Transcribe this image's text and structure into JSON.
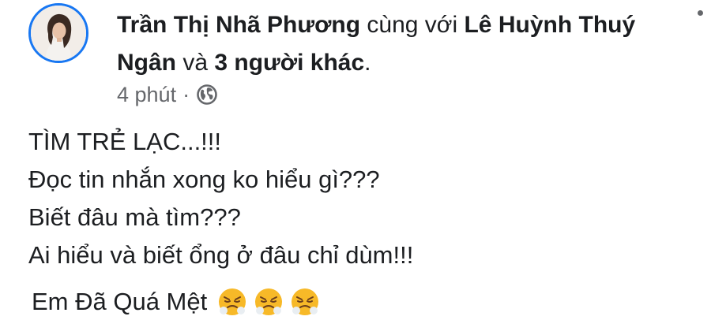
{
  "post": {
    "author": "Trần Thị Nhã Phương",
    "with_text": "cùng với",
    "tagged": "Lê Huỳnh Thuý Ngân",
    "and_text": "và",
    "others": "3 người khác",
    "period": ".",
    "time": "4 phút",
    "separator": "·",
    "privacy_icon": "globe-icon",
    "avatar_icon": "profile-photo",
    "more_icon": "more-options-dot"
  },
  "content": {
    "lines": [
      "TÌM TRẺ LẠC...!!!",
      "Đọc tin nhắn xong ko hiểu gì???",
      "Biết đâu mà tìm???",
      "Ai hiểu và biết ổng ở đâu chỉ dùm!!!"
    ],
    "last_line": "Em Đã Quá Mệt",
    "emoji_icon": "face-with-steam-from-nose",
    "emoji_count": 3
  },
  "colors": {
    "text": "#1c1e21",
    "meta": "#65676b",
    "avatar_ring": "#1877f2",
    "emoji_face": "#f7b928"
  }
}
